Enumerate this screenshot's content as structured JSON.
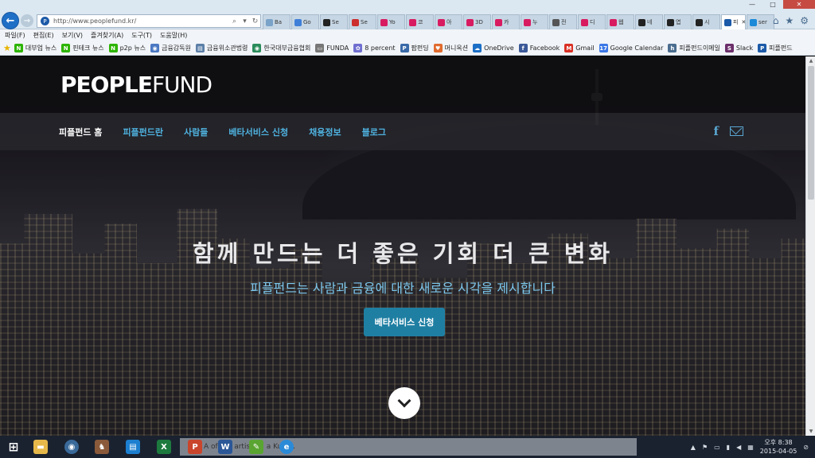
{
  "browser": {
    "url": "http://www.peoplefund.kr/",
    "tabs": [
      "Ba",
      "Go",
      "Se",
      "Se",
      "Yo",
      "코",
      "아",
      "3D",
      "카",
      "누",
      "전",
      "디",
      "웹",
      "네",
      "엽",
      "시",
      "피",
      "ser"
    ],
    "tab_colors": [
      "#7aa3c9",
      "#3f7fd8",
      "#222222",
      "#cc2d2d",
      "#d81b60",
      "#d81b60",
      "#d81b60",
      "#d81b60",
      "#d81b60",
      "#d81b60",
      "#555555",
      "#d81b60",
      "#d81b60",
      "#222222",
      "#222222",
      "#222222",
      "#1c5aa8",
      "#1c8ad8"
    ],
    "active_tab_label": "피",
    "window_controls": {
      "minimize": "—",
      "maximize": "□",
      "close": "✕"
    }
  },
  "menubar": [
    "파일(F)",
    "편집(E)",
    "보기(V)",
    "즐겨찾기(A)",
    "도구(T)",
    "도움말(H)"
  ],
  "favorites": [
    {
      "label": "대부업 뉴스",
      "icon": "N",
      "color": "#2db400"
    },
    {
      "label": "핀테크 뉴스",
      "icon": "N",
      "color": "#2db400"
    },
    {
      "label": "p2p 뉴스",
      "icon": "N",
      "color": "#2db400"
    },
    {
      "label": "금융감독원",
      "icon": "◉",
      "color": "#4a78c2"
    },
    {
      "label": "금융위소관법령",
      "icon": "▤",
      "color": "#5b7fa8"
    },
    {
      "label": "한국대부금융협회",
      "icon": "◉",
      "color": "#2a8c5a"
    },
    {
      "label": "FUNDA",
      "icon": "▭",
      "color": "#777777"
    },
    {
      "label": "8 percent",
      "icon": "✿",
      "color": "#6f6fd0"
    },
    {
      "label": "팝펀딩",
      "icon": "P",
      "color": "#3a6aa8"
    },
    {
      "label": "머니옥션",
      "icon": "♥",
      "color": "#e06b2f"
    },
    {
      "label": "OneDrive",
      "icon": "☁",
      "color": "#1c6fc6"
    },
    {
      "label": "Facebook",
      "icon": "f",
      "color": "#3b5998"
    },
    {
      "label": "Gmail",
      "icon": "M",
      "color": "#d93025"
    },
    {
      "label": "Google Calendar",
      "icon": "17",
      "color": "#3b78e7"
    },
    {
      "label": "피플펀드이메일",
      "icon": "h",
      "color": "#4a6d8f"
    },
    {
      "label": "Slack",
      "icon": "S",
      "color": "#6b2f6b"
    },
    {
      "label": "피플펀드",
      "icon": "P",
      "color": "#1c5aa8"
    }
  ],
  "site": {
    "logo_a": "PEOPLE",
    "logo_b": "FUND",
    "nav": [
      "피플펀드 홈",
      "피플펀드란",
      "사람들",
      "베타서비스 신청",
      "채용정보",
      "블로그"
    ],
    "social": {
      "facebook": "f"
    },
    "hero_title": "함께 만드는 더 좋은 기회 더 큰 변화",
    "hero_subtitle": "피플펀드는 사람과 금융에 대한 새로운 시각을 제시합니다",
    "cta_label": "베타서비스 신청"
  },
  "taskbar": {
    "toast": "A",
    "toast_tail": "of the artist, Vi",
    "toast_tail2": "a Kuras.",
    "clock_ampm": "오후 8:38",
    "date": "2015-04-05"
  },
  "colors": {
    "accent": "#1f7fa3",
    "nav_link": "#4fb3e0",
    "subtitle": "#7cc7ec"
  }
}
